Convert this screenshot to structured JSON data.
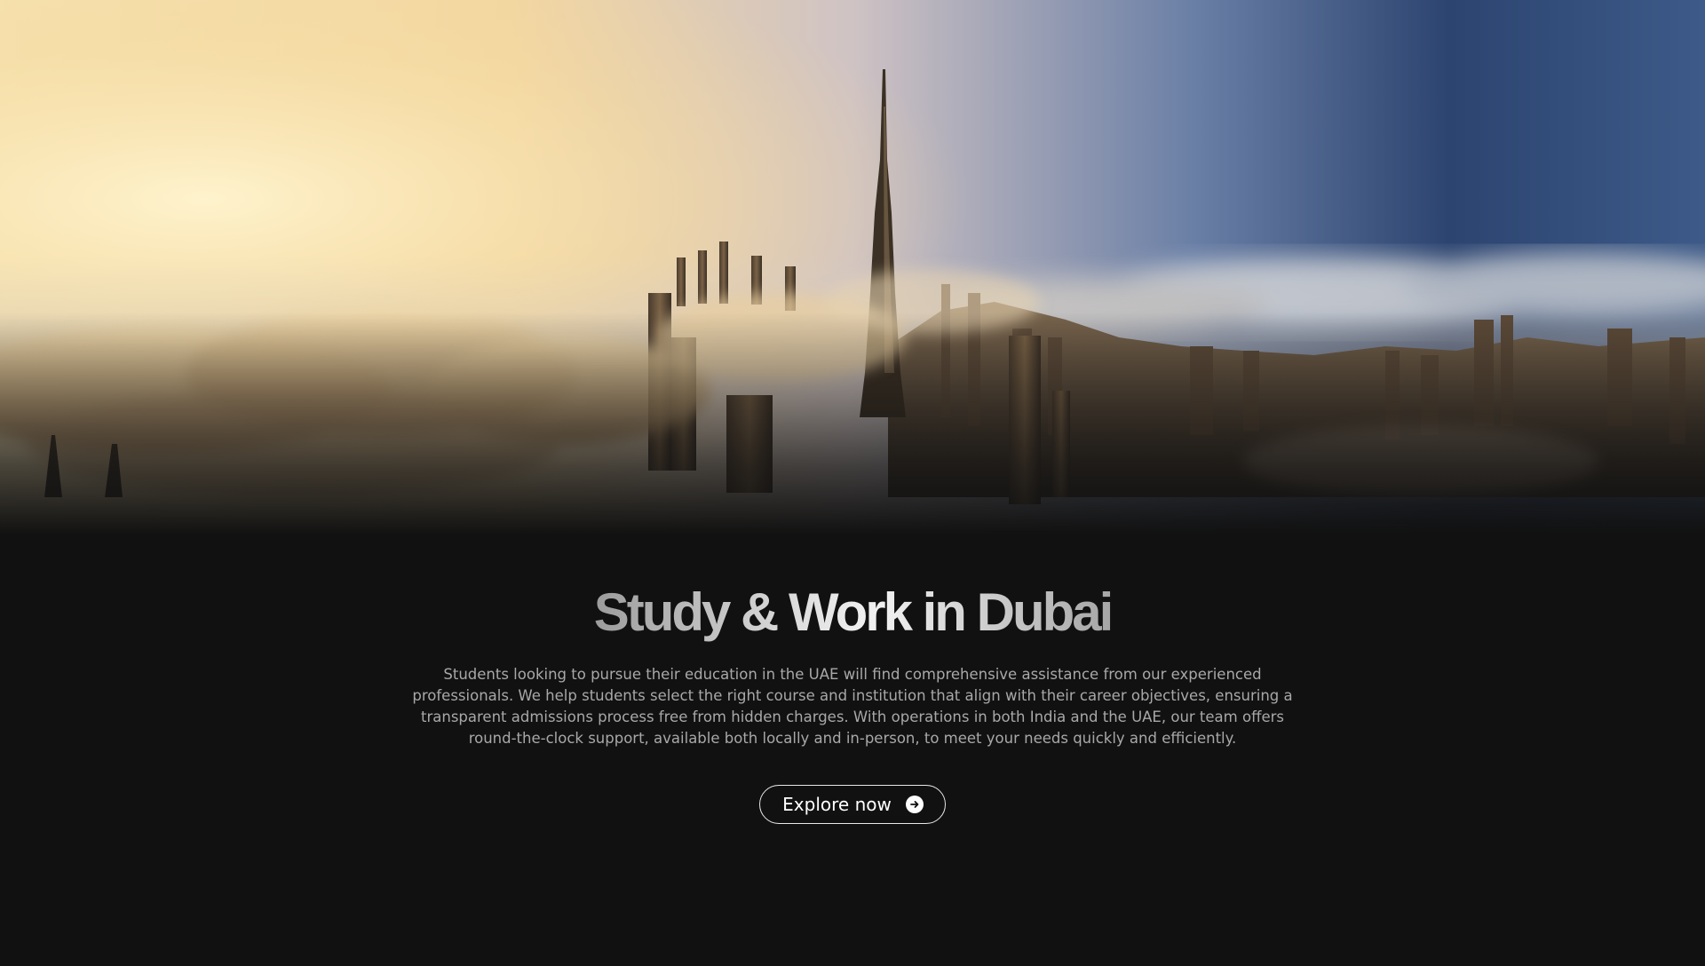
{
  "hero": {
    "image": "dubai-skyline-above-clouds",
    "colors": {
      "sky_warm": "#f4d79c",
      "sky_blue": "#2f4a78",
      "background": "#111111"
    }
  },
  "main": {
    "title": "Study & Work in Dubai",
    "description": "Students looking to pursue their education in the UAE will find comprehensive assistance from our experienced professionals. We help students select the right course and institution that align with their career objectives, ensuring a transparent admissions process free from hidden charges. With operations in both India and the UAE, our team offers round-the-clock support, available both locally and in-person, to meet your needs quickly and efficiently.",
    "cta": {
      "label": "Explore now",
      "icon": "arrow-right-circle-icon"
    }
  }
}
